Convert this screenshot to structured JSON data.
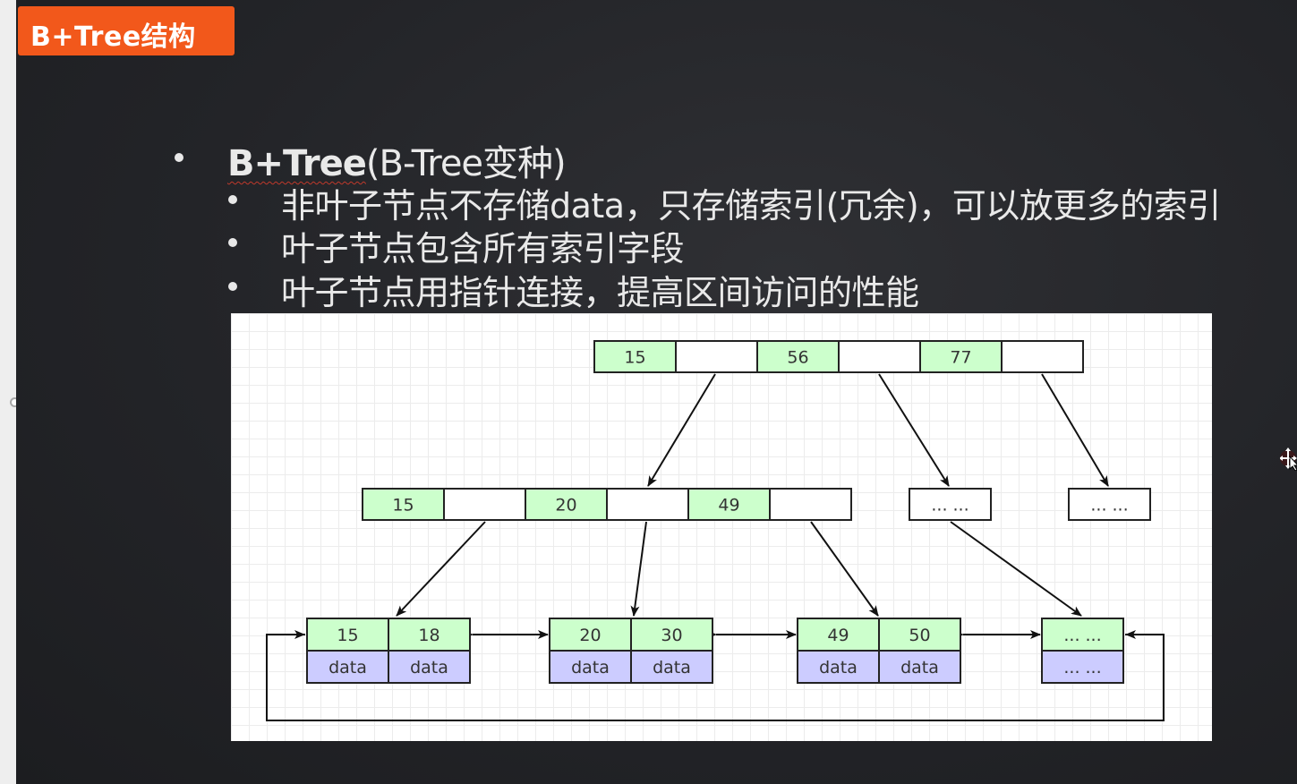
{
  "title_badge": "B+Tree结构",
  "heading": {
    "strong": "B+Tree",
    "rest": "(B-Tree变种)"
  },
  "bullets": [
    "非叶子节点不存储data，只存储索引(冗余)，可以放更多的索引",
    "叶子节点包含所有索引字段",
    "叶子节点用指针连接，提高区间访问的性能"
  ],
  "colors": {
    "key_cell": "#ccffcc",
    "data_cell": "#ccccff",
    "badge": "#f2581b"
  },
  "tree": {
    "root": [
      "15",
      "56",
      "77"
    ],
    "level2": [
      "15",
      "20",
      "49"
    ],
    "level2_placeholders": [
      "... ...",
      "... ..."
    ],
    "leaves": [
      {
        "keys": [
          "15",
          "18"
        ],
        "data": [
          "data",
          "data"
        ]
      },
      {
        "keys": [
          "20",
          "30"
        ],
        "data": [
          "data",
          "data"
        ]
      },
      {
        "keys": [
          "49",
          "50"
        ],
        "data": [
          "data",
          "data"
        ]
      },
      {
        "keys": [
          "... ..."
        ],
        "data": [
          "... ..."
        ]
      }
    ]
  },
  "icons": {
    "cursor": "move-cursor-icon",
    "handle": "slider-handle-icon"
  }
}
